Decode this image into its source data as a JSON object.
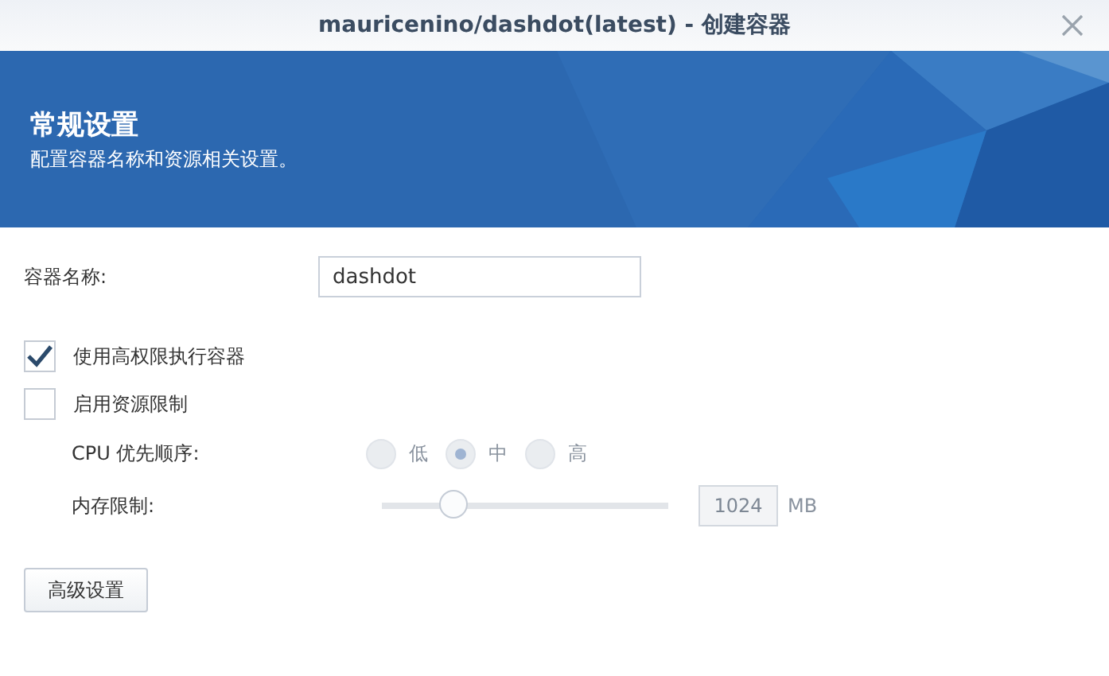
{
  "window": {
    "title": "mauricenino/dashdot(latest) - 创建容器"
  },
  "header": {
    "title": "常规设置",
    "subtitle": "配置容器名称和资源相关设置。"
  },
  "name_field": {
    "label": "容器名称:",
    "value": "dashdot"
  },
  "checkboxes": [
    {
      "label": "使用高权限执行容器",
      "checked": true
    },
    {
      "label": "启用资源限制",
      "checked": false
    }
  ],
  "cpu_priority": {
    "label": "CPU 优先顺序:",
    "disabled": true,
    "options": [
      {
        "label": "低",
        "selected": false
      },
      {
        "label": "中",
        "selected": true
      },
      {
        "label": "高",
        "selected": false
      }
    ]
  },
  "memory_limit": {
    "label": "内存限制:",
    "disabled": true,
    "level": 0.24,
    "value": "1024",
    "unit": "MB"
  },
  "buttons": [
    "高级设置"
  ]
}
